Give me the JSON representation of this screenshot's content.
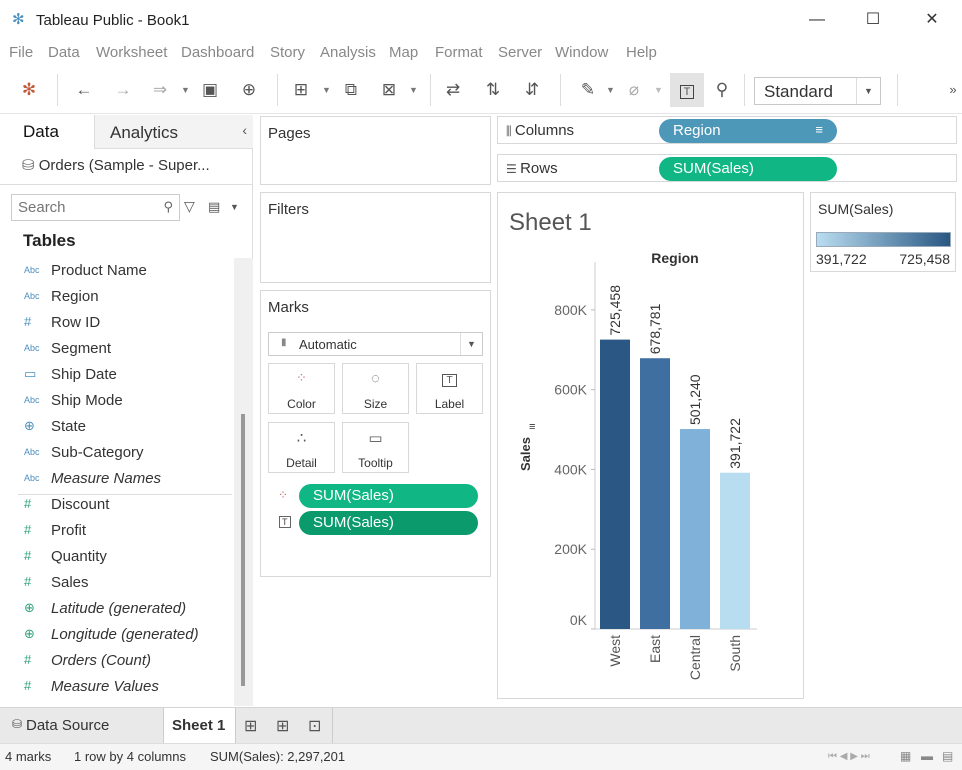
{
  "window": {
    "title": "Tableau Public - Book1"
  },
  "menu": [
    "File",
    "Data",
    "Worksheet",
    "Dashboard",
    "Story",
    "Analysis",
    "Map",
    "Format",
    "Server",
    "Window",
    "Help"
  ],
  "toolbar": {
    "fit_mode": "Standard",
    "overflow": "»"
  },
  "left_pane": {
    "tabs": [
      "Data",
      "Analytics"
    ],
    "datasource": "Orders (Sample - Super...",
    "search_placeholder": "Search",
    "tables_heading": "Tables",
    "dimensions": [
      {
        "type": "Abc",
        "name": "Product Name"
      },
      {
        "type": "Abc",
        "name": "Region"
      },
      {
        "type": "#",
        "name": "Row ID"
      },
      {
        "type": "Abc",
        "name": "Segment"
      },
      {
        "type": "date",
        "name": "Ship Date"
      },
      {
        "type": "Abc",
        "name": "Ship Mode"
      },
      {
        "type": "geo",
        "name": "State"
      },
      {
        "type": "Abc",
        "name": "Sub-Category"
      },
      {
        "type": "Abc",
        "name": "Measure Names"
      }
    ],
    "measures": [
      {
        "type": "#",
        "name": "Discount"
      },
      {
        "type": "#",
        "name": "Profit"
      },
      {
        "type": "#",
        "name": "Quantity"
      },
      {
        "type": "#",
        "name": "Sales"
      },
      {
        "type": "geo",
        "name": "Latitude (generated)"
      },
      {
        "type": "geo",
        "name": "Longitude (generated)"
      },
      {
        "type": "#",
        "name": "Orders (Count)"
      },
      {
        "type": "#",
        "name": "Measure Values"
      }
    ]
  },
  "cards": {
    "pages": "Pages",
    "filters": "Filters",
    "marks": "Marks",
    "mark_type": "Automatic",
    "mark_buttons": [
      "Color",
      "Size",
      "Label",
      "Detail",
      "Tooltip"
    ],
    "mark_pills": [
      "SUM(Sales)",
      "SUM(Sales)"
    ]
  },
  "shelves": {
    "columns_label": "Columns",
    "columns_pill": "Region",
    "rows_label": "Rows",
    "rows_pill": "SUM(Sales)"
  },
  "legend": {
    "title": "SUM(Sales)",
    "min": "391,722",
    "max": "725,458"
  },
  "colors": {
    "pill_green": "#10b683",
    "pill_teal": "#4d98b8",
    "accent": "#4a8fbf"
  },
  "chart_data": {
    "type": "bar",
    "title": "Sheet 1",
    "header": "Region",
    "categories": [
      "West",
      "East",
      "Central",
      "South"
    ],
    "values": [
      725458,
      678781,
      501240,
      391722
    ],
    "value_labels": [
      "725,458",
      "678,781",
      "501,240",
      "391,722"
    ],
    "colors": [
      "#2a5783",
      "#3f6fa0",
      "#7fb1d9",
      "#b9ddf0"
    ],
    "ylabel": "Sales",
    "yticks": [
      "0K",
      "200K",
      "400K",
      "600K",
      "800K"
    ],
    "ytick_values": [
      0,
      200000,
      400000,
      600000,
      800000
    ],
    "ylim": [
      0,
      920000
    ],
    "grid": false
  },
  "bottom_tabs": {
    "datasource": "Data Source",
    "sheet": "Sheet 1"
  },
  "status": {
    "marks": "4 marks",
    "dims": "1 row by 4 columns",
    "sum": "SUM(Sales): 2,297,201"
  }
}
